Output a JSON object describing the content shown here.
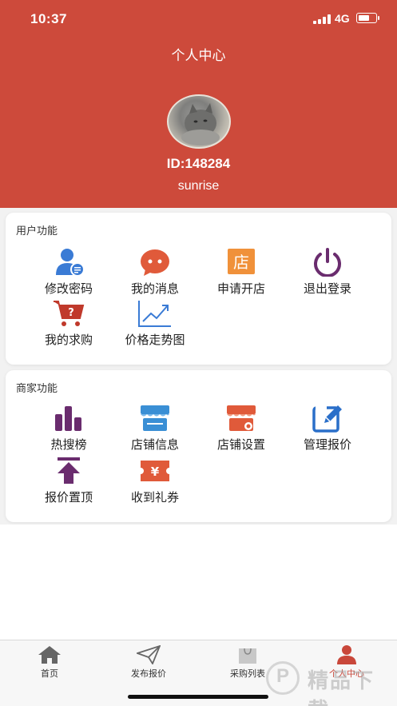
{
  "status": {
    "time": "10:37",
    "network": "4G"
  },
  "header": {
    "title": "个人中心",
    "user_id": "ID:148284",
    "username": "sunrise"
  },
  "user_section": {
    "title": "用户功能",
    "items": [
      {
        "label": "修改密码",
        "icon": "user-password-icon",
        "color": "#3a7bd5"
      },
      {
        "label": "我的消息",
        "icon": "message-icon",
        "color": "#e05a3a"
      },
      {
        "label": "申请开店",
        "icon": "store-apply-icon",
        "color": "#f0913a"
      },
      {
        "label": "退出登录",
        "icon": "power-icon",
        "color": "#6a2c6e"
      },
      {
        "label": "我的求购",
        "icon": "shopping-cart-icon",
        "color": "#c0392b"
      },
      {
        "label": "价格走势图",
        "icon": "trend-chart-icon",
        "color": "#3a7bd5"
      }
    ]
  },
  "merchant_section": {
    "title": "商家功能",
    "items": [
      {
        "label": "热搜榜",
        "icon": "bar-chart-icon",
        "color": "#6a2c6e"
      },
      {
        "label": "店铺信息",
        "icon": "shop-info-icon",
        "color": "#3a8fd5"
      },
      {
        "label": "店铺设置",
        "icon": "shop-settings-icon",
        "color": "#e05a3a"
      },
      {
        "label": "管理报价",
        "icon": "edit-icon",
        "color": "#2a6fc9"
      },
      {
        "label": "报价置顶",
        "icon": "pin-top-icon",
        "color": "#6a2c6e"
      },
      {
        "label": "收到礼券",
        "icon": "coupon-icon",
        "color": "#e05a3a"
      }
    ]
  },
  "tabs": [
    {
      "label": "首页",
      "icon": "home-icon",
      "active": false
    },
    {
      "label": "发布报价",
      "icon": "paper-plane-icon",
      "active": false
    },
    {
      "label": "采购列表",
      "icon": "shopping-bag-icon",
      "active": false
    },
    {
      "label": "个人中心",
      "icon": "person-icon",
      "active": true
    }
  ],
  "watermark": {
    "text": "精品下载"
  },
  "colors": {
    "header": "#cd4a3b",
    "active_tab": "#c9473a"
  }
}
